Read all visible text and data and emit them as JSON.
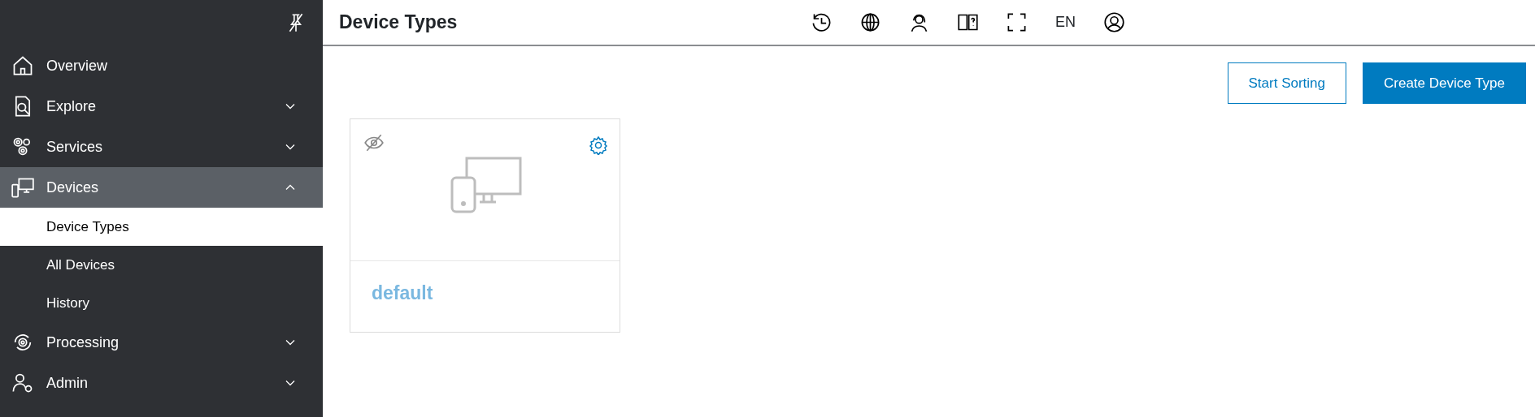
{
  "header": {
    "title": "Device Types",
    "language": "EN"
  },
  "sidebar": {
    "items": [
      {
        "label": "Overview",
        "kind": "link",
        "selected": false
      },
      {
        "label": "Explore",
        "kind": "group",
        "selected": false,
        "expanded": false
      },
      {
        "label": "Services",
        "kind": "group",
        "selected": false,
        "expanded": false
      },
      {
        "label": "Devices",
        "kind": "group",
        "selected": true,
        "expanded": true,
        "children": [
          {
            "label": "Device Types",
            "selected": true
          },
          {
            "label": "All Devices",
            "selected": false
          },
          {
            "label": "History",
            "selected": false
          }
        ]
      },
      {
        "label": "Processing",
        "kind": "group",
        "selected": false,
        "expanded": false
      },
      {
        "label": "Admin",
        "kind": "group",
        "selected": false,
        "expanded": false
      }
    ]
  },
  "toolbar": {
    "buttons": [
      {
        "label": "Start Sorting",
        "kind": "secondary"
      },
      {
        "label": "Create Device Type",
        "kind": "primary"
      }
    ]
  },
  "cards": [
    {
      "name": "default",
      "hidden": true
    }
  ]
}
